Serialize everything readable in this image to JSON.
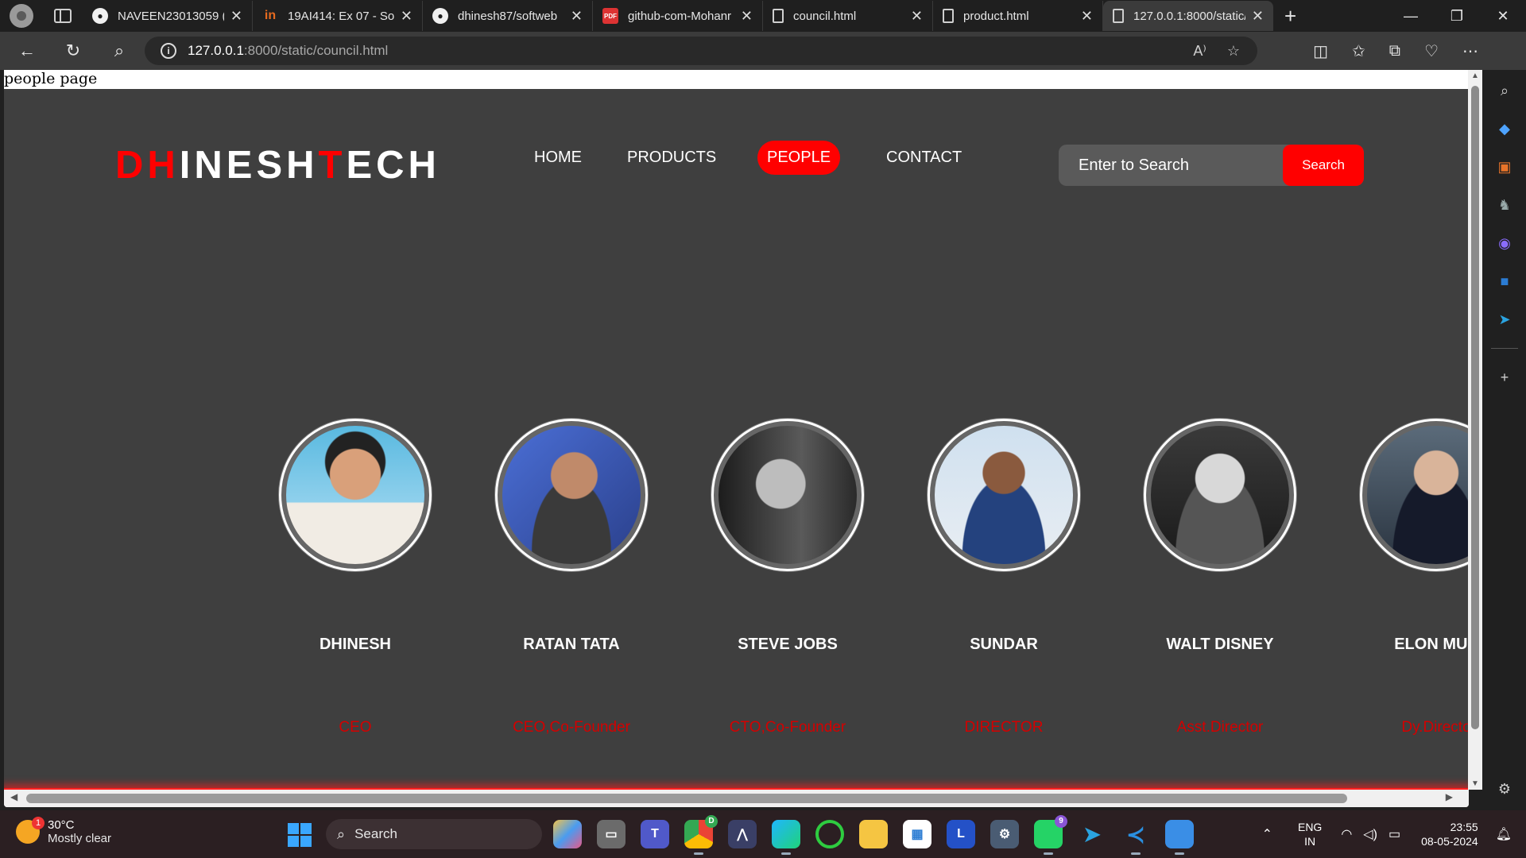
{
  "browser": {
    "tabs": [
      {
        "title": "NAVEEN23013059 (N",
        "icon": "github-icon"
      },
      {
        "title": "19AI414: Ex 07 - Soft",
        "icon": "in-icon"
      },
      {
        "title": "dhinesh87/softweb",
        "icon": "github-icon"
      },
      {
        "title": "github-com-Mohanr",
        "icon": "pdf-icon"
      },
      {
        "title": "council.html",
        "icon": "file-icon"
      },
      {
        "title": "product.html",
        "icon": "file-icon"
      },
      {
        "title": "127.0.0.1:8000/static/",
        "icon": "file-icon",
        "active": true
      }
    ],
    "url_host": "127.0.0.1",
    "url_path": ":8000/static/council.html"
  },
  "page": {
    "caption": "people page",
    "logo": {
      "d": "D",
      "hines": "H",
      "i": "INESH",
      "t": "T",
      "ech": "ECH"
    },
    "nav": {
      "home": "HOME",
      "products": "PRODUCTS",
      "people": "PEOPLE",
      "contact": "CONTACT"
    },
    "search": {
      "placeholder": "Enter to Search",
      "button": "Search"
    },
    "people": [
      {
        "name": "DHINESH",
        "role": "CEO"
      },
      {
        "name": "RATAN TATA",
        "role": "CEO,Co-Founder"
      },
      {
        "name": "STEVE JOBS",
        "role": "CTO,Co-Founder"
      },
      {
        "name": "SUNDAR",
        "role": "DIRECTOR"
      },
      {
        "name": "WALT DISNEY",
        "role": "Asst.Director"
      },
      {
        "name": "ELON MUS",
        "role": "Dy.Directo"
      }
    ],
    "colors": {
      "accent": "#ff0000",
      "background": "#3f3f3f",
      "role_text": "#d40000"
    }
  },
  "taskbar": {
    "weather_temp": "30°C",
    "weather_desc": "Mostly clear",
    "weather_badge": "1",
    "search": "Search",
    "lang_1": "ENG",
    "lang_2": "IN",
    "time": "23:55",
    "date": "08-05-2024",
    "whatsapp_badge": "9",
    "chrome_badge": "D"
  }
}
